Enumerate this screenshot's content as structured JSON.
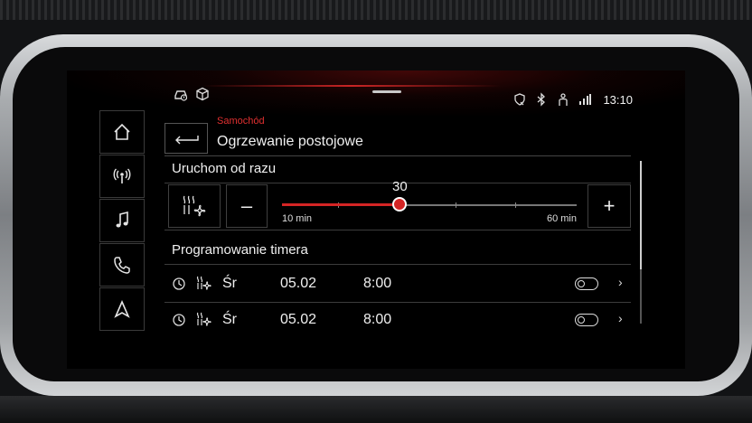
{
  "status": {
    "time": "13:10"
  },
  "header": {
    "breadcrumb": "Samochód",
    "title": "Ogrzewanie postojowe"
  },
  "start_now": {
    "title": "Uruchom od razu",
    "value": "30",
    "min_label": "10 min",
    "max_label": "60 min",
    "minus_label": "–",
    "plus_label": "+",
    "min": 10,
    "max": 60,
    "current": 30
  },
  "timer": {
    "title": "Programowanie timera",
    "rows": [
      {
        "day": "Śr",
        "date": "05.02",
        "time": "8:00",
        "enabled": false
      },
      {
        "day": "Śr",
        "date": "05.02",
        "time": "8:00",
        "enabled": false
      }
    ]
  },
  "colors": {
    "accent": "#d42424",
    "text": "#f0f0f0",
    "background": "#000000"
  },
  "icons": {
    "nav": [
      "home-icon",
      "radio-icon",
      "music-icon",
      "phone-icon",
      "navigation-icon"
    ],
    "status_left": [
      "car-service-icon",
      "cube-icon"
    ],
    "status_right": [
      "shield-icon",
      "bluetooth-icon",
      "person-icon",
      "signal-icon"
    ]
  }
}
